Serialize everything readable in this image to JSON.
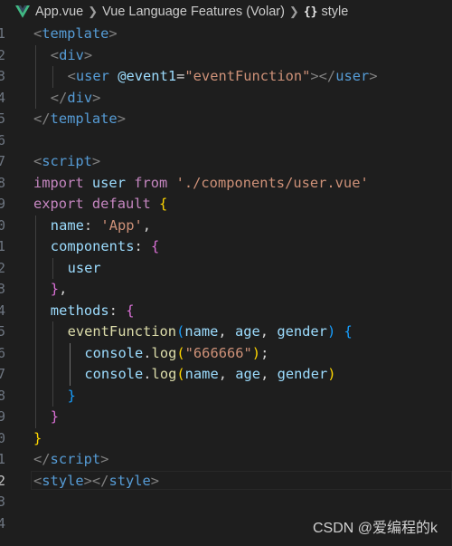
{
  "breadcrumb": {
    "file": "App.vue",
    "extension": "Vue Language Features (Volar)",
    "symbol": "style",
    "icons": [
      "vue-logo-icon",
      "chevron-right-icon",
      "braces-icon"
    ]
  },
  "editor": {
    "language": "vue",
    "active_line_index": 21,
    "gutter_digits": [
      "1",
      "2",
      "3",
      "4",
      "5",
      "6",
      "7",
      "8",
      "9",
      "0",
      "1",
      "2",
      "3",
      "4",
      "5",
      "6",
      "7",
      "8",
      "9",
      "0",
      "1",
      "2",
      "3",
      "4"
    ],
    "lines": [
      [
        {
          "t": "<",
          "c": "punct"
        },
        {
          "t": "template",
          "c": "tag"
        },
        {
          "t": ">",
          "c": "punct"
        }
      ],
      [
        {
          "t": "<",
          "c": "punct"
        },
        {
          "t": "div",
          "c": "tag"
        },
        {
          "t": ">",
          "c": "punct"
        }
      ],
      [
        {
          "t": "<",
          "c": "punct"
        },
        {
          "t": "user",
          "c": "tag"
        },
        {
          "t": " ",
          "c": "text"
        },
        {
          "t": "@event1",
          "c": "attr"
        },
        {
          "t": "=",
          "c": "text"
        },
        {
          "t": "\"eventFunction\"",
          "c": "str"
        },
        {
          "t": "></",
          "c": "punct"
        },
        {
          "t": "user",
          "c": "tag"
        },
        {
          "t": ">",
          "c": "punct"
        }
      ],
      [
        {
          "t": "</",
          "c": "punct"
        },
        {
          "t": "div",
          "c": "tag"
        },
        {
          "t": ">",
          "c": "punct"
        }
      ],
      [
        {
          "t": "</",
          "c": "punct"
        },
        {
          "t": "template",
          "c": "tag"
        },
        {
          "t": ">",
          "c": "punct"
        }
      ],
      [],
      [
        {
          "t": "<",
          "c": "punct"
        },
        {
          "t": "script",
          "c": "tag"
        },
        {
          "t": ">",
          "c": "punct"
        }
      ],
      [
        {
          "t": "import",
          "c": "kw"
        },
        {
          "t": " ",
          "c": "text"
        },
        {
          "t": "user",
          "c": "var"
        },
        {
          "t": " ",
          "c": "text"
        },
        {
          "t": "from",
          "c": "kw"
        },
        {
          "t": " ",
          "c": "text"
        },
        {
          "t": "'./components/user.vue'",
          "c": "str"
        }
      ],
      [
        {
          "t": "export",
          "c": "kw"
        },
        {
          "t": " ",
          "c": "text"
        },
        {
          "t": "default",
          "c": "kw"
        },
        {
          "t": " ",
          "c": "text"
        },
        {
          "t": "{",
          "c": "b1"
        }
      ],
      [
        {
          "t": "name",
          "c": "var"
        },
        {
          "t": ": ",
          "c": "text"
        },
        {
          "t": "'App'",
          "c": "str"
        },
        {
          "t": ",",
          "c": "text"
        }
      ],
      [
        {
          "t": "components",
          "c": "var"
        },
        {
          "t": ": ",
          "c": "text"
        },
        {
          "t": "{",
          "c": "b2"
        }
      ],
      [
        {
          "t": "user",
          "c": "var"
        }
      ],
      [
        {
          "t": "}",
          "c": "b2"
        },
        {
          "t": ",",
          "c": "text"
        }
      ],
      [
        {
          "t": "methods",
          "c": "var"
        },
        {
          "t": ": ",
          "c": "text"
        },
        {
          "t": "{",
          "c": "b2"
        }
      ],
      [
        {
          "t": "eventFunction",
          "c": "fn"
        },
        {
          "t": "(",
          "c": "b3"
        },
        {
          "t": "name",
          "c": "var"
        },
        {
          "t": ", ",
          "c": "text"
        },
        {
          "t": "age",
          "c": "var"
        },
        {
          "t": ", ",
          "c": "text"
        },
        {
          "t": "gender",
          "c": "var"
        },
        {
          "t": ")",
          "c": "b3"
        },
        {
          "t": " ",
          "c": "text"
        },
        {
          "t": "{",
          "c": "b3"
        }
      ],
      [
        {
          "t": "console",
          "c": "var"
        },
        {
          "t": ".",
          "c": "text"
        },
        {
          "t": "log",
          "c": "fn"
        },
        {
          "t": "(",
          "c": "b1"
        },
        {
          "t": "\"666666\"",
          "c": "str"
        },
        {
          "t": ")",
          "c": "b1"
        },
        {
          "t": ";",
          "c": "text"
        }
      ],
      [
        {
          "t": "console",
          "c": "var"
        },
        {
          "t": ".",
          "c": "text"
        },
        {
          "t": "log",
          "c": "fn"
        },
        {
          "t": "(",
          "c": "b1"
        },
        {
          "t": "name",
          "c": "var"
        },
        {
          "t": ", ",
          "c": "text"
        },
        {
          "t": "age",
          "c": "var"
        },
        {
          "t": ", ",
          "c": "text"
        },
        {
          "t": "gender",
          "c": "var"
        },
        {
          "t": ")",
          "c": "b1"
        }
      ],
      [
        {
          "t": "}",
          "c": "b3"
        }
      ],
      [
        {
          "t": "}",
          "c": "b2"
        }
      ],
      [
        {
          "t": "}",
          "c": "b1"
        }
      ],
      [
        {
          "t": "</",
          "c": "punct"
        },
        {
          "t": "script",
          "c": "tag"
        },
        {
          "t": ">",
          "c": "punct"
        }
      ],
      [
        {
          "t": "<",
          "c": "punct"
        },
        {
          "t": "style",
          "c": "tag"
        },
        {
          "t": "></",
          "c": "punct"
        },
        {
          "t": "style",
          "c": "tag"
        },
        {
          "t": ">",
          "c": "punct"
        }
      ],
      [],
      []
    ]
  },
  "watermark": "CSDN @爱编程的k"
}
